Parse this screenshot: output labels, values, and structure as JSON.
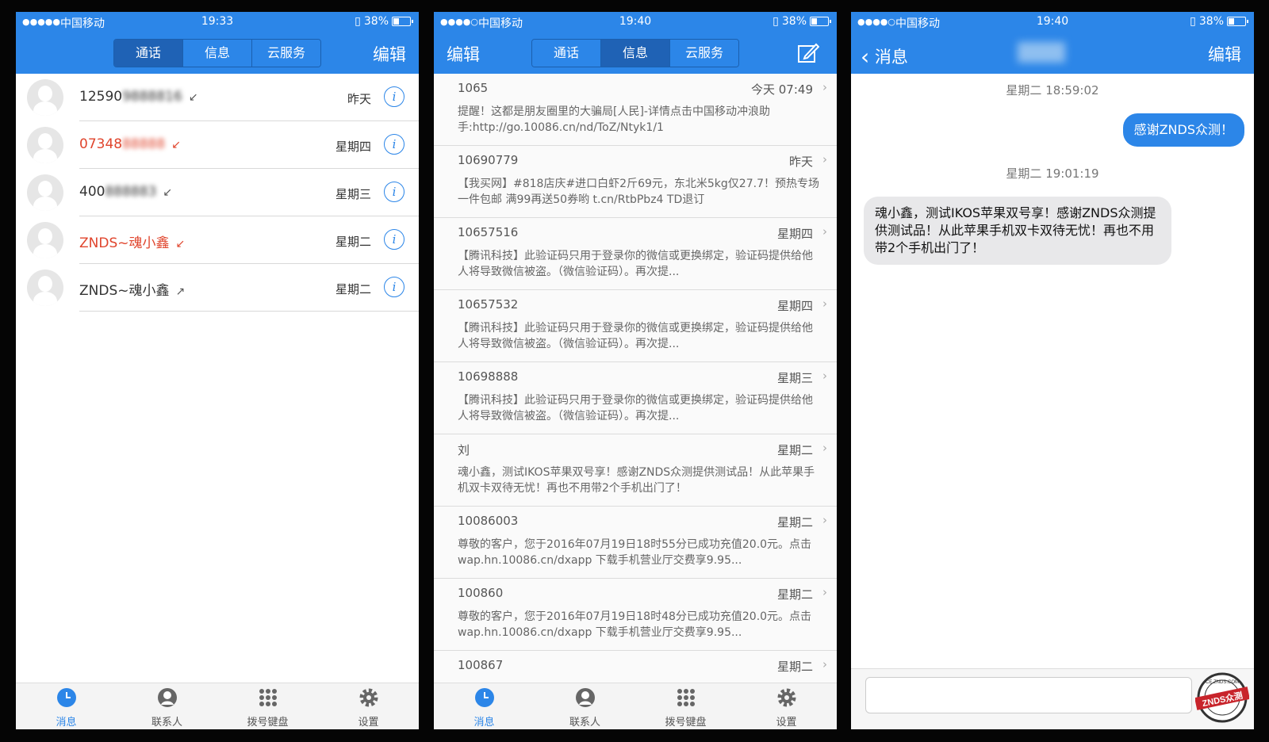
{
  "status": [
    {
      "dots": "●●●●●",
      "carrier": "中国移动",
      "time": "19:33",
      "battery": "38%"
    },
    {
      "dots": "●●●●○",
      "carrier": "中国移动",
      "time": "19:40",
      "battery": "38%"
    },
    {
      "dots": "●●●●○",
      "carrier": "中国移动",
      "time": "19:40",
      "battery": "38%"
    }
  ],
  "segments": [
    "通话",
    "信息",
    "云服务"
  ],
  "nav": {
    "edit": "编辑",
    "back": "消息"
  },
  "calls": [
    {
      "name": "12590",
      "day": "昨天",
      "arrow": "↙",
      "missed": false
    },
    {
      "name": "07348",
      "day": "星期四",
      "arrow": "↙",
      "missed": true
    },
    {
      "name": "400",
      "day": "星期三",
      "arrow": "↙",
      "missed": false
    },
    {
      "name": "ZNDS~魂小鑫",
      "day": "星期二",
      "arrow": "↙",
      "missed": true
    },
    {
      "name": "ZNDS~魂小鑫",
      "day": "星期二",
      "arrow": "↗",
      "missed": false
    }
  ],
  "messages": [
    {
      "num": "1065",
      "date": "今天 07:49",
      "body": "提醒！这都是朋友圈里的大骗局[人民]-详情点击中国移动冲浪助手:http://go.10086.cn/nd/ToZ/Ntyk1/1"
    },
    {
      "num": "10690779",
      "date": "昨天",
      "body": "【我买网】#818店庆#进口白虾2斤69元，东北米5kg仅27.7！预热专场一件包邮 满99再送50券哟 t.cn/RtbPbz4 TD退订"
    },
    {
      "num": "10657516",
      "date": "星期四",
      "body": "【腾讯科技】此验证码只用于登录你的微信或更换绑定，验证码提供给他人将导致微信被盗。（微信验证码）。再次提..."
    },
    {
      "num": "10657532",
      "date": "星期四",
      "body": "【腾讯科技】此验证码只用于登录你的微信或更换绑定，验证码提供给他人将导致微信被盗。（微信验证码）。再次提..."
    },
    {
      "num": "10698888",
      "date": "星期三",
      "body": "【腾讯科技】此验证码只用于登录你的微信或更换绑定，验证码提供给他人将导致微信被盗。（微信验证码）。再次提..."
    },
    {
      "num": "刘",
      "date": "星期二",
      "body": "魂小鑫，测试IKOS苹果双号享！感谢ZNDS众测提供测试品！从此苹果手机双卡双待无忧！再也不用带2个手机出门了！"
    },
    {
      "num": "10086003",
      "date": "星期二",
      "body": "尊敬的客户，您于2016年07月19日18时55分已成功充值20.0元。点击 wap.hn.10086.cn/dxapp 下载手机营业厅交费享9.95..."
    },
    {
      "num": "100860",
      "date": "星期二",
      "body": "尊敬的客户，您于2016年07月19日18时48分已成功充值20.0元。点击 wap.hn.10086.cn/dxapp 下载手机营业厅交费享9.95..."
    },
    {
      "num": "100867",
      "date": "星期二",
      "body": ""
    }
  ],
  "tabs": [
    "消息",
    "联系人",
    "拨号键盘",
    "设置"
  ],
  "chat": {
    "time1": "星期二 18:59:02",
    "out": "感谢ZNDS众测！",
    "time2": "星期二 19:01:19",
    "in": "魂小鑫，测试IKOS苹果双号享！感谢ZNDS众测提供测试品！从此苹果手机双卡双待无忧！再也不用带2个手机出门了！"
  },
  "watermark": {
    "text": "ZNDS众测",
    "sub": "CE.ZNDS.COM"
  },
  "colors": {
    "accent": "#2c86e8",
    "missed": "#e0452d"
  }
}
